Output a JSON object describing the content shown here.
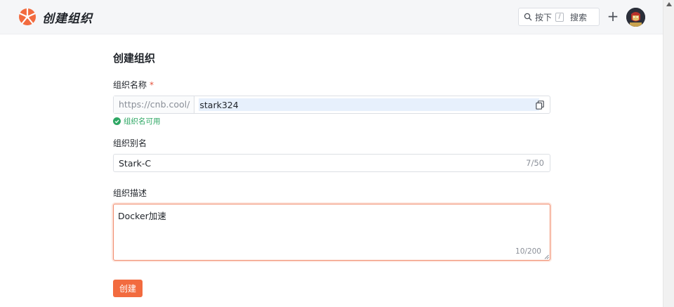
{
  "header": {
    "brand": "创建组织",
    "search_prefix": "按下",
    "search_key": "/",
    "search_label": "搜索",
    "plus": "+"
  },
  "form": {
    "title": "创建组织",
    "name_label": "组织名称",
    "required_mark": "*",
    "url_prefix": "https://cnb.cool/",
    "name_value": "stark324",
    "name_hint": "组织名可用",
    "alias_label": "组织别名",
    "alias_value": "Stark-C",
    "alias_count": "7/50",
    "desc_label": "组织描述",
    "desc_value": "Docker加速",
    "desc_count": "10/200",
    "submit_label": "创建"
  },
  "colors": {
    "accent": "#f26b3f",
    "success": "#2ea764",
    "required": "#e5533d"
  },
  "icons": [
    "logo-icon",
    "search-icon",
    "copy-icon",
    "check-circle-icon",
    "avatar"
  ]
}
